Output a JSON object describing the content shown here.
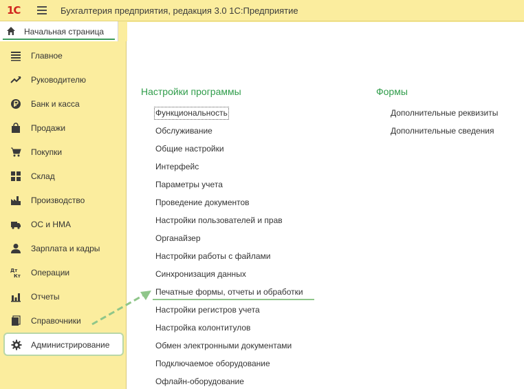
{
  "app": {
    "logo": "1С",
    "title": "Бухгалтерия предприятия, редакция 3.0 1С:Предприятие"
  },
  "home_tab": {
    "label": "Начальная страница"
  },
  "sidebar": {
    "items": [
      {
        "label": "Главное",
        "icon": "list-icon"
      },
      {
        "label": "Руководителю",
        "icon": "trend-icon"
      },
      {
        "label": "Банк и касса",
        "icon": "ruble-icon"
      },
      {
        "label": "Продажи",
        "icon": "bag-icon"
      },
      {
        "label": "Покупки",
        "icon": "cart-icon"
      },
      {
        "label": "Склад",
        "icon": "warehouse-icon"
      },
      {
        "label": "Производство",
        "icon": "factory-icon"
      },
      {
        "label": "ОС и НМА",
        "icon": "truck-icon"
      },
      {
        "label": "Зарплата и кадры",
        "icon": "person-icon"
      },
      {
        "label": "Операции",
        "icon": "debit-credit-icon",
        "icon_text": "Дт\nКт"
      },
      {
        "label": "Отчеты",
        "icon": "bar-chart-icon"
      },
      {
        "label": "Справочники",
        "icon": "books-icon"
      },
      {
        "label": "Администрирование",
        "icon": "gear-icon",
        "active": true
      }
    ]
  },
  "content": {
    "settings": {
      "title": "Настройки программы",
      "links": [
        "Функциональность",
        "Обслуживание",
        "Общие настройки",
        "Интерфейс",
        "Параметры учета",
        "Проведение документов",
        "Настройки пользователей и прав",
        "Органайзер",
        "Настройки работы с файлами",
        "Синхронизация данных",
        "Печатные формы, отчеты и обработки",
        "Настройки регистров учета",
        "Настройка колонтитулов",
        "Обмен электронными документами",
        "Подключаемое оборудование",
        "Офлайн-оборудование"
      ]
    },
    "forms": {
      "title": "Формы",
      "links": [
        "Дополнительные реквизиты",
        "Дополнительные сведения"
      ]
    }
  },
  "colors": {
    "sidebar_bg": "#fbed9e",
    "section_title": "#2f9c4a",
    "highlight": "#8fc68a",
    "logo_red": "#d0261e"
  }
}
